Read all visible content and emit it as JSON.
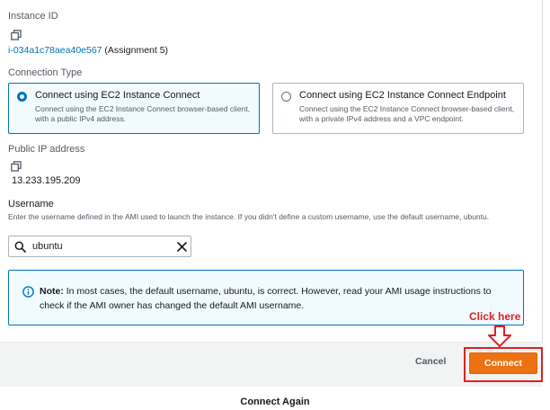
{
  "instance": {
    "id_label": "Instance ID",
    "id_link": "i-034a1c78aea40e567",
    "id_suffix": " (Assignment 5)"
  },
  "connection_type": {
    "label": "Connection Type",
    "options": [
      {
        "title": "Connect using EC2 Instance Connect",
        "description": "Connect using the EC2 Instance Connect browser-based client, with a public IPv4 address.",
        "selected": true
      },
      {
        "title": "Connect using EC2 Instance Connect Endpoint",
        "description": "Connect using the EC2 Instance Connect browser-based client, with a private IPv4 address and a VPC endpoint.",
        "selected": false
      }
    ]
  },
  "public_ip": {
    "label": "Public IP address",
    "value": "13.233.195.209"
  },
  "username": {
    "label": "Username",
    "description": "Enter the username defined in the AMI used to launch the instance. If you didn't define a custom username, use the default username, ubuntu.",
    "value": "ubuntu"
  },
  "info": {
    "prefix": "Note:",
    "text": " In most cases, the default username, ubuntu, is correct. However, read your AMI usage instructions to check if the AMI owner has changed the default AMI username."
  },
  "footer": {
    "cancel_label": "Cancel",
    "connect_label": "Connect"
  },
  "annotation": {
    "click_here": "Click here",
    "color": "#e02020"
  },
  "connect_again": "Connect Again",
  "colors": {
    "accent": "#0073bb",
    "primary_button": "#ec7211"
  }
}
